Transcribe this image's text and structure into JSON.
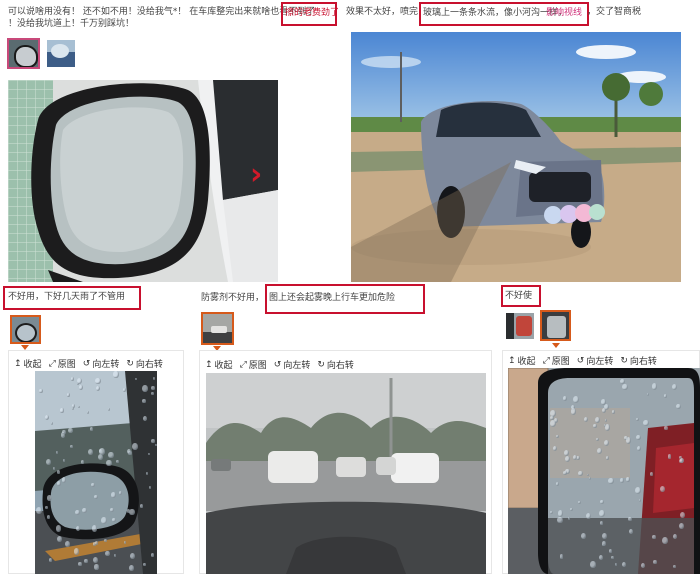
{
  "top_left": {
    "line1": "可以说啥用没有！ 还不如不用！没给我气*！ 在车库整完出来就啥也看不到了",
    "highlight": "擦的老费劲了",
    "line2": "！没给我坑道上！千万别踩坑！"
  },
  "top_right": {
    "part1": "效果不太好，喷完，",
    "highlight": "玻璃上一条条水流，像小河沟一样，",
    "pink": "影响视线",
    "part2": "，交了智商税"
  },
  "next_arrow": "›",
  "review2": {
    "label": "不好用，下好几天雨了不管用"
  },
  "review3": {
    "prefix": "防雾剂不好用，",
    "highlight": "图上还会起雾晚上行车更加危险"
  },
  "review4": {
    "label": "不好使"
  },
  "toolbar": {
    "collapse": "收起",
    "original": "原图",
    "rotate_left": "向左转",
    "rotate_right": "向右转"
  },
  "colors": {
    "highlight_red": "#c8102e",
    "selected_orange": "#d65a1b",
    "pink_text": "#d0317a"
  }
}
